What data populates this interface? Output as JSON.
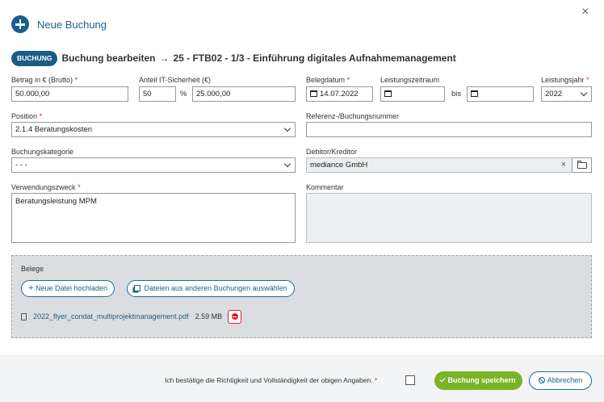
{
  "header": {
    "title": "Neue Buchung",
    "close_symbol": "×"
  },
  "booking": {
    "badge": "BUCHUNG",
    "heading": "Buchung bearbeiten",
    "arrow": "→",
    "project": "25 - FTB02 - 1/3 - Einführung digitales Aufnahmemanagement"
  },
  "form": {
    "betrag": {
      "label": "Betrag in € (Brutto)",
      "required": "*",
      "value": "50.000,00"
    },
    "anteil": {
      "label": "Anteil IT-Sicherheit (€)",
      "percent_value": "50",
      "percent_symbol": "%",
      "amount_value": "25.000,00"
    },
    "belegdatum": {
      "label": "Belegdatum",
      "required": "*",
      "value": "14.07.2022"
    },
    "leistungszeitraum": {
      "label": "Leistungszeitraum",
      "from_value": "",
      "separator": "bis",
      "to_value": ""
    },
    "leistungsjahr": {
      "label": "Leistungsjahr",
      "required": "*",
      "value": "2022"
    },
    "position": {
      "label": "Position",
      "required": "*",
      "value": "2.1.4 Beratungskosten"
    },
    "referenz": {
      "label": "Referenz-/Buchungsnummer",
      "value": ""
    },
    "kategorie": {
      "label": "Buchungskategorie",
      "value": "- - -"
    },
    "debitor": {
      "label": "Debitor/Kreditor",
      "value": "mediance GmbH",
      "clear_symbol": "×"
    },
    "verwendungszweck": {
      "label": "Verwendungszweck",
      "required": "*",
      "value": "Beratungsleistung MPM"
    },
    "kommentar": {
      "label": "Kommentar",
      "value": ""
    }
  },
  "belege": {
    "title": "Belege",
    "upload_label": "Neue Datei hochladen",
    "select_label": "Dateien aus anderen Buchungen auswählen",
    "files": [
      {
        "name": "2022_flyer_condat_multiprojektmanagement.pdf",
        "size": "2.59 MB"
      }
    ]
  },
  "footer": {
    "confirm_text": "Ich bestätige die Richtigkeit und Vollständigkeit der obigen Angaben.",
    "required": "*",
    "save_label": "Buchung speichern",
    "cancel_label": "Abbrechen"
  },
  "colors": {
    "primary": "#1a6a9a",
    "badge": "#1b5c86",
    "save_green": "#7ab427",
    "danger": "#d9232d",
    "dropzone_bg": "#dadee1"
  }
}
